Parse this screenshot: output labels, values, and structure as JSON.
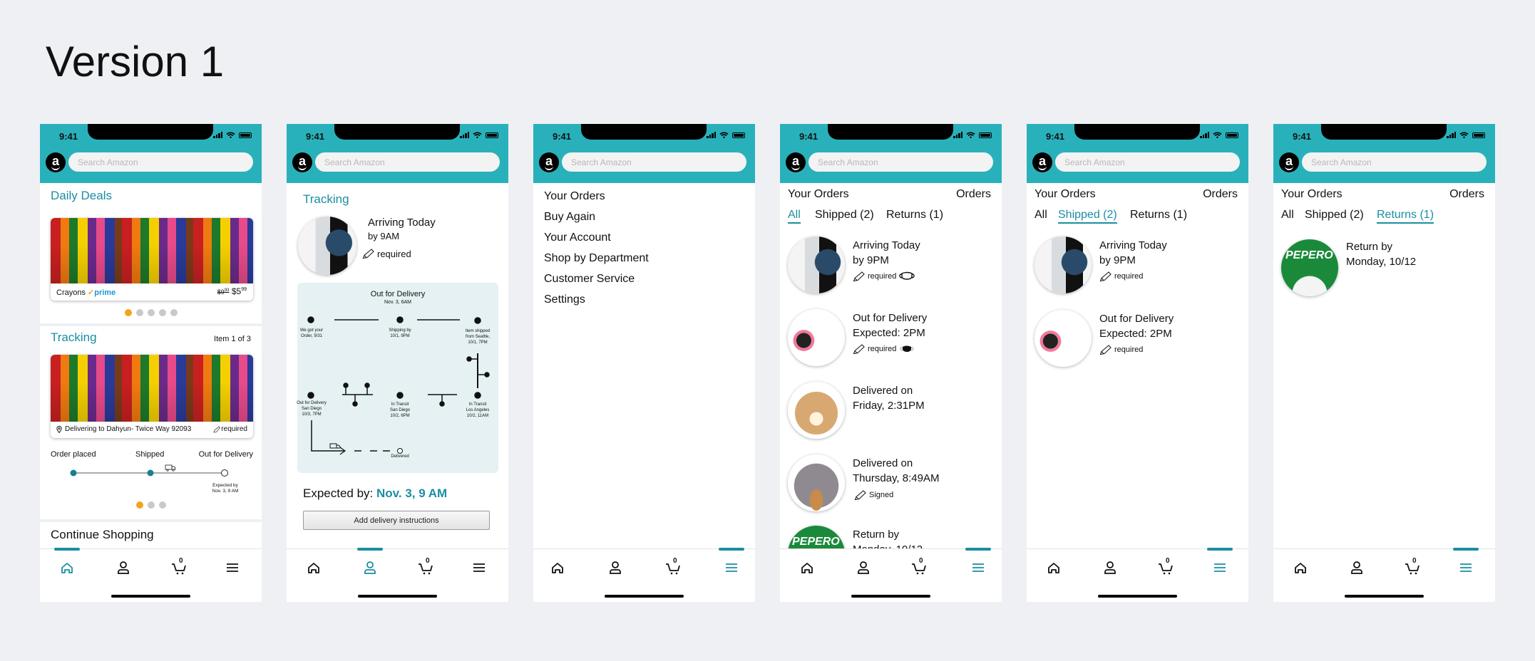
{
  "page_title": "Version 1",
  "status_bar": {
    "time": "9:41"
  },
  "header": {
    "logo_letter": "a",
    "search_placeholder": "Search Amazon"
  },
  "nav": {
    "items": [
      "home-icon",
      "account-icon",
      "cart-icon",
      "menu-icon"
    ],
    "cart_count": "0"
  },
  "colors": {
    "header": "#29b1bb",
    "accent": "#1a8ea0",
    "dot_active": "#f7a21b",
    "map_bg": "#e5f1f3"
  },
  "home": {
    "daily_deals_title": "Daily Deals",
    "deal": {
      "name": "Crayons",
      "prime_check": "✓",
      "prime": "prime",
      "old_price": "$9",
      "old_price_cents": "93",
      "price": "$5",
      "price_cents": "99"
    },
    "deal_dots": {
      "count": 5,
      "active": 1
    },
    "tracking_title": "Tracking",
    "item_counter": "Item 1 of 3",
    "delivering_to": "Delivering to Dahyun- Twice Way 92093",
    "required": "required",
    "steps": [
      "Order placed",
      "Shipped",
      "Out for Delivery"
    ],
    "progress_completed_steps": 2,
    "expected": "Expected by",
    "expected_date": "Nov. 3, 9 AM",
    "tracking_dots": {
      "count": 3,
      "active": 1
    },
    "continue_title": "Continue Shopping"
  },
  "tracking": {
    "title": "Tracking",
    "status": "Arriving Today",
    "time": "by 9AM",
    "required": "required",
    "map_title": "Out for Delivery",
    "map_date": "Nov. 3, 6AM",
    "events": [
      {
        "line1": "We got your",
        "line2": "Order, 9/31"
      },
      {
        "line1": "Shipping by",
        "line2": "10/1, 9PM"
      },
      {
        "line1": "Item shipped",
        "line2": "from Seattle,",
        "line3": "10/1, 7PM"
      },
      {
        "line1": "Out for Delivery",
        "line2": "San Diego",
        "line3": "10/3, 7PM"
      },
      {
        "line1": "In Transit",
        "line2": "San Diego",
        "line3": "10/2, 6PM"
      },
      {
        "line1": "In Transit",
        "line2": "Los Angeles",
        "line3": "10/2, 11AM"
      },
      {
        "line1": "Delivered"
      }
    ],
    "expected_label": "Expected by:",
    "expected_value": "Nov. 3, 9 AM",
    "button": "Add delivery instructions"
  },
  "menu": {
    "items": [
      "Your Orders",
      "Buy Again",
      "Your Account",
      "Shop by Department",
      "Customer Service",
      "Settings"
    ]
  },
  "orders": {
    "title": "Your Orders",
    "right_label": "Orders",
    "tabs": [
      "All",
      "Shipped (2)",
      "Returns (1)"
    ],
    "items": [
      {
        "line1": "Arriving Today",
        "line2": "by 9PM",
        "note": "required",
        "icon": "mask-white-icon"
      },
      {
        "line1": "Out for Delivery",
        "line2": "Expected: 2PM",
        "note": "required",
        "icon": "mask-black-icon"
      },
      {
        "line1": "Delivered on",
        "line2": "Friday, 2:31PM"
      },
      {
        "line1": "Delivered on",
        "line2": "Thursday, 8:49AM",
        "note": "Signed"
      },
      {
        "line1": "Return by",
        "line2": "Monday, 10/12",
        "image_text": "PEPERO"
      }
    ]
  }
}
